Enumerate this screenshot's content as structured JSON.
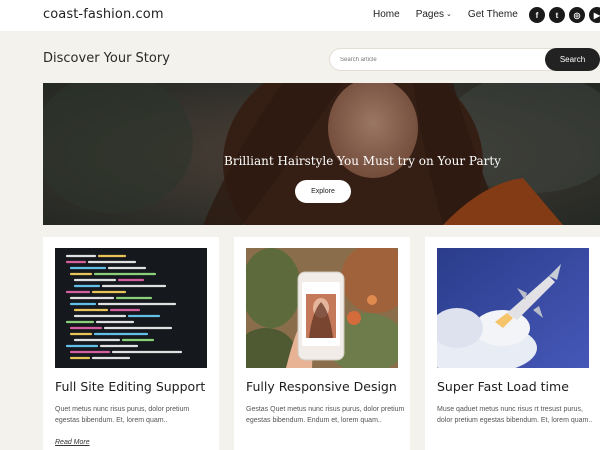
{
  "header": {
    "site_title": "coast-fashion.com",
    "nav": [
      {
        "label": "Home"
      },
      {
        "label": "Pages",
        "has_dropdown": true
      },
      {
        "label": "Get Theme"
      }
    ],
    "socials": [
      {
        "name": "facebook-icon",
        "glyph": "f"
      },
      {
        "name": "twitter-icon",
        "glyph": "t"
      },
      {
        "name": "instagram-icon",
        "glyph": "◎"
      },
      {
        "name": "youtube-icon",
        "glyph": "▶"
      }
    ]
  },
  "discover": {
    "heading": "Discover Your Story",
    "search_placeholder": "Search article",
    "search_button": "Search"
  },
  "hero": {
    "title": "Brilliant Hairstyle You Must try on Your Party",
    "button": "Explore"
  },
  "cards": [
    {
      "image": "code-screen-image",
      "title": "Full Site Editing Support",
      "text": "Quet metus nunc risus purus, dolor pretium egestas bibendum. Et, lorem quam..",
      "link": "Read More"
    },
    {
      "image": "phone-photo-image",
      "title": "Fully Responsive Design",
      "text": "Gestas Quet metus nunc risus purus, dolor pretium egestas bibendum. Endum et, lorem quam..",
      "link": ""
    },
    {
      "image": "rocket-launch-image",
      "title": "Super Fast Load time",
      "text": "Muse qaduet metus nunc risus rt tresust purus, dolor pretium egestas bibendum. Et, lorem quam..",
      "link": ""
    }
  ]
}
